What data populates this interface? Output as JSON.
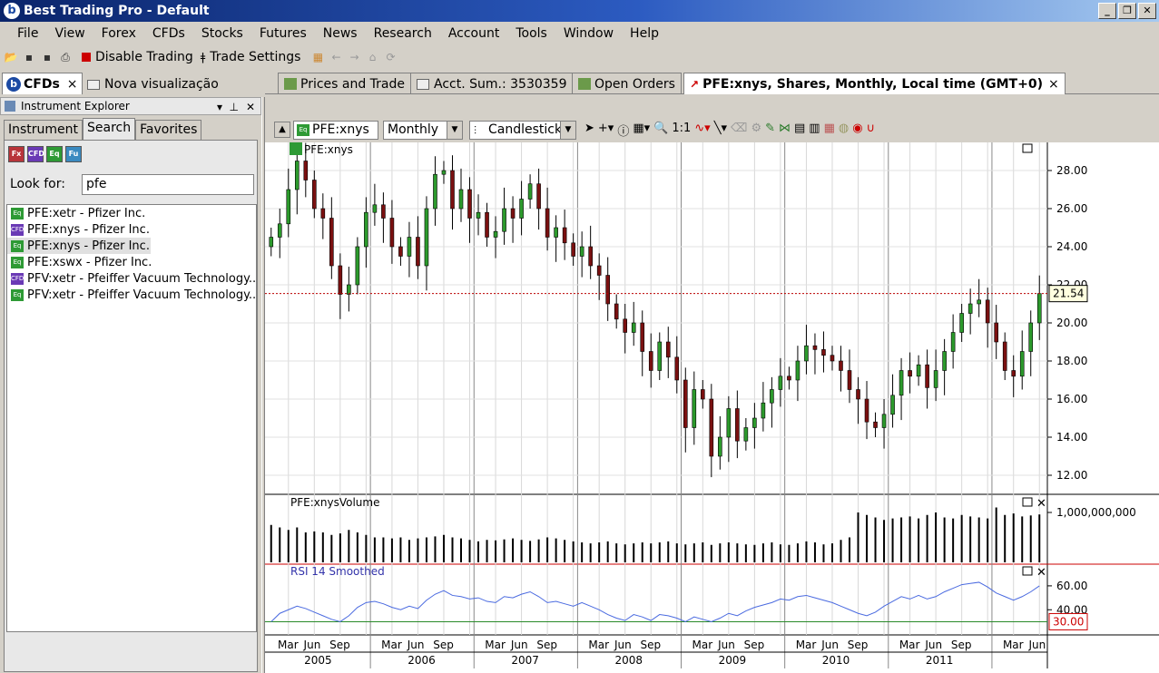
{
  "app": {
    "title": "Best Trading Pro - Default",
    "logo": "b"
  },
  "menu": [
    "File",
    "View",
    "Forex",
    "CFDs",
    "Stocks",
    "Futures",
    "News",
    "Research",
    "Account",
    "Tools",
    "Window",
    "Help"
  ],
  "toolbar": {
    "disable_trading": "Disable Trading",
    "trade_settings": "Trade Settings"
  },
  "workspace_tabs": [
    {
      "label": "CFDs",
      "close": "×"
    },
    {
      "label": "Nova visualização"
    }
  ],
  "doc_tabs": [
    {
      "label": "Prices and Trade"
    },
    {
      "label": "Acct. Sum.: 3530359"
    },
    {
      "label": "Open Orders"
    },
    {
      "label": "PFE:xnys, Shares, Monthly, Local time (GMT+0)",
      "close": "×"
    }
  ],
  "explorer": {
    "title": "Instrument Explorer",
    "tabs": [
      "Instrument",
      "Search",
      "Favorites"
    ],
    "active_tab": "Search",
    "filters": [
      "Fx",
      "CFD",
      "Eq",
      "Fu"
    ],
    "look_for_label": "Look for:",
    "look_for_value": "pfe",
    "results": [
      {
        "tag": "Eq",
        "label": "PFE:xetr - Pfizer Inc."
      },
      {
        "tag": "CFD",
        "label": "PFE:xnys - Pfizer Inc."
      },
      {
        "tag": "Eq",
        "label": "PFE:xnys - Pfizer Inc.",
        "selected": true
      },
      {
        "tag": "Eq",
        "label": "PFE:xswx - Pfizer Inc."
      },
      {
        "tag": "CFD",
        "label": "PFV:xetr - Pfeiffer Vacuum Technology..."
      },
      {
        "tag": "Eq",
        "label": "PFV:xetr - Pfeiffer Vacuum Technology..."
      }
    ]
  },
  "chart_toolbar": {
    "instrument": "PFE:xnys",
    "period": "Monthly",
    "chart_type": "Candlestick"
  },
  "chart_data": {
    "type": "candlestick",
    "instrument_label": "PFE:xnys",
    "volume_label": "PFE:xnysVolume",
    "rsi_label": "RSI 14 Smoothed",
    "price_ticks": [
      "28.00",
      "26.00",
      "24.00",
      "22.00",
      "20.00",
      "18.00",
      "16.00",
      "14.00",
      "12.00"
    ],
    "last_price": "21.54",
    "volume_tick": "1,000,000,000",
    "rsi_ticks": [
      "60.00",
      "40.00"
    ],
    "rsi_level": "30.00",
    "months": [
      "Mar",
      "Jun",
      "Sep"
    ],
    "years": [
      "2005",
      "2006",
      "2007",
      "2008",
      "2009",
      "2010",
      "2011"
    ],
    "close": [
      24.5,
      25.2,
      27.0,
      28.5,
      27.5,
      26.0,
      25.5,
      23.0,
      21.5,
      22.0,
      24.0,
      25.8,
      26.2,
      25.5,
      24.0,
      23.5,
      24.5,
      23.0,
      26.0,
      27.8,
      28.0,
      26.0,
      27.0,
      25.5,
      25.8,
      24.5,
      24.8,
      26.0,
      25.5,
      26.5,
      27.3,
      26.0,
      24.5,
      25.0,
      24.2,
      23.5,
      24.0,
      23.0,
      22.5,
      21.0,
      20.2,
      19.5,
      20.0,
      18.5,
      17.5,
      19.0,
      18.2,
      17.0,
      14.5,
      16.5,
      16.0,
      13.0,
      14.0,
      15.5,
      13.8,
      14.5,
      15.0,
      15.8,
      16.5,
      17.2,
      17.0,
      18.0,
      18.8,
      18.6,
      18.3,
      18.0,
      17.5,
      16.5,
      16.0,
      14.8,
      14.5,
      15.2,
      16.2,
      17.5,
      17.2,
      17.8,
      16.6,
      17.5,
      18.5,
      19.5,
      20.5,
      21.0,
      21.2,
      20.0,
      19.0,
      17.5,
      17.2,
      18.5,
      20.0,
      21.54
    ],
    "volume": [
      0.75,
      0.7,
      0.65,
      0.7,
      0.6,
      0.62,
      0.6,
      0.55,
      0.58,
      0.65,
      0.6,
      0.55,
      0.5,
      0.5,
      0.48,
      0.5,
      0.45,
      0.48,
      0.5,
      0.52,
      0.55,
      0.5,
      0.48,
      0.45,
      0.42,
      0.45,
      0.44,
      0.46,
      0.48,
      0.45,
      0.43,
      0.46,
      0.5,
      0.48,
      0.45,
      0.42,
      0.4,
      0.38,
      0.4,
      0.42,
      0.38,
      0.36,
      0.38,
      0.4,
      0.38,
      0.4,
      0.42,
      0.38,
      0.36,
      0.38,
      0.4,
      0.35,
      0.38,
      0.4,
      0.38,
      0.36,
      0.35,
      0.38,
      0.4,
      0.36,
      0.35,
      0.38,
      0.42,
      0.4,
      0.36,
      0.38,
      0.45,
      0.5,
      1.0,
      0.95,
      0.9,
      0.85,
      0.88,
      0.9,
      0.92,
      0.88,
      0.95,
      1.0,
      0.9,
      0.88,
      0.95,
      0.92,
      0.9,
      0.88,
      1.1,
      0.95,
      0.98,
      0.92,
      0.94,
      0.96
    ],
    "rsi": [
      30,
      37,
      40,
      43,
      41,
      38,
      35,
      32,
      30,
      35,
      42,
      46,
      47,
      45,
      42,
      40,
      43,
      41,
      48,
      53,
      56,
      52,
      51,
      49,
      50,
      47,
      46,
      51,
      50,
      53,
      55,
      51,
      46,
      47,
      45,
      43,
      46,
      43,
      40,
      36,
      33,
      31,
      36,
      34,
      31,
      36,
      35,
      33,
      30,
      34,
      32,
      30,
      33,
      37,
      35,
      39,
      42,
      44,
      46,
      49,
      48,
      51,
      52,
      50,
      48,
      46,
      43,
      40,
      37,
      35,
      38,
      43,
      47,
      51,
      49,
      52,
      49,
      51,
      55,
      58,
      61,
      62,
      63,
      59,
      54,
      51,
      48,
      51,
      55,
      60
    ]
  }
}
